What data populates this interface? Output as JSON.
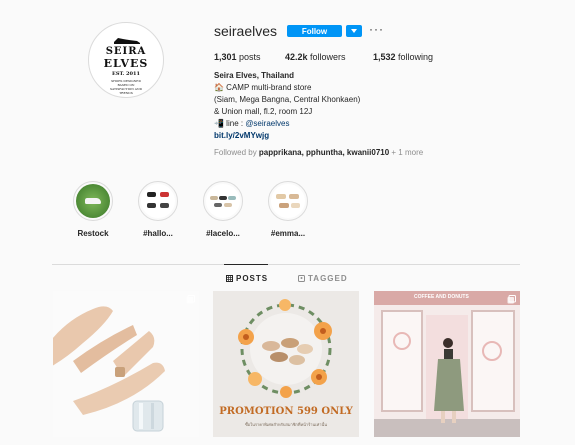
{
  "profile": {
    "username": "seiraelves",
    "follow_label": "Follow",
    "more_label": "···",
    "logo_line1": "SEIRA",
    "logo_line2": "ELVES",
    "logo_est": "EST. 2011",
    "logo_tagline": "SHOES DESIGNED BASED ON SATISFACTION AND TRENDS"
  },
  "stats": {
    "posts_count": "1,301",
    "posts_label": "posts",
    "followers_count": "42.2k",
    "followers_label": "followers",
    "following_count": "1,532",
    "following_label": "following"
  },
  "bio": {
    "name": "Seira Elves, Thailand",
    "line1": "🏠 CAMP multi-brand store",
    "line2": "(Siam, Mega Bangna, Central Khonkaen)",
    "line3": "& Union mall, fl.2, room 12J",
    "line4_prefix": "📲 line : ",
    "line4_handle": "@seiraelves",
    "link": "bit.ly/2vMYwjg",
    "followed_prefix": "Followed by ",
    "followed_names": "papprikana, pphuntha, kwanii0710",
    "followed_more": " + 1 more"
  },
  "highlights": [
    {
      "label": "Restock"
    },
    {
      "label": "#hallo..."
    },
    {
      "label": "#lacelo..."
    },
    {
      "label": "#emma..."
    }
  ],
  "tabs": {
    "posts": "POSTS",
    "tagged": "TAGGED"
  },
  "posts": {
    "promo_text": "PROMOTION  599 ONLY",
    "promo_small": "ซื้อในราคาพิเศษสำหรับสมาชิกที่หน้าร้านเท่านั้น",
    "shop_sign": "COFFEE AND DONUTS"
  },
  "colors": {
    "accent": "#0095f6",
    "link": "#00376b",
    "muted": "#8e8e8e",
    "border": "#dbdbdb"
  }
}
